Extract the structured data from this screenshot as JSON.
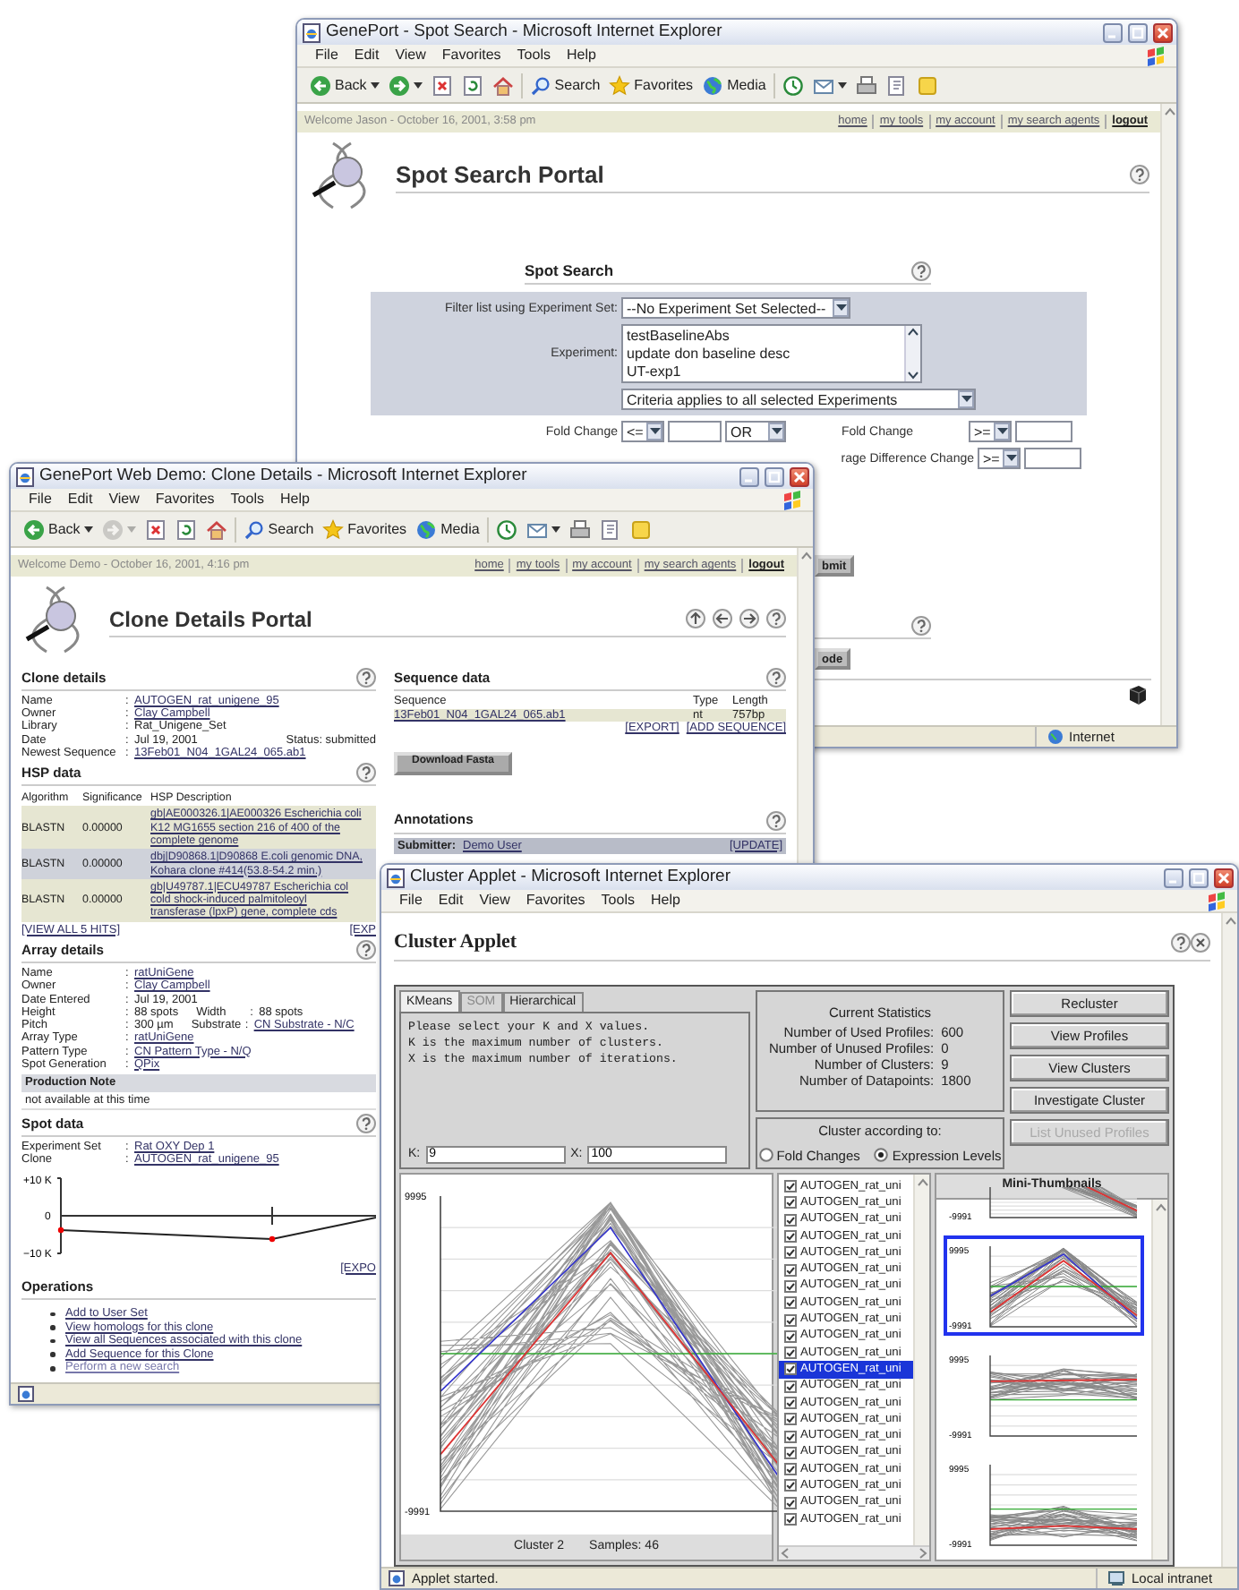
{
  "spot_search_window": {
    "title": "GenePort - Spot Search - Microsoft Internet Explorer",
    "menu": [
      "File",
      "Edit",
      "View",
      "Favorites",
      "Tools",
      "Help"
    ],
    "toolbar": [
      {
        "kind": "back",
        "label": "Back",
        "disabled": false
      },
      {
        "kind": "forward",
        "disabled": false
      },
      {
        "kind": "stop",
        "disabled": false
      },
      {
        "kind": "refresh",
        "disabled": false
      },
      {
        "kind": "home",
        "disabled": false
      },
      {
        "kind": "search",
        "label": "Search",
        "disabled": false
      },
      {
        "kind": "favorites",
        "label": "Favorites",
        "disabled": false
      },
      {
        "kind": "media",
        "label": "Media",
        "disabled": false
      },
      {
        "kind": "history",
        "disabled": false
      },
      {
        "kind": "mail",
        "disabled": false
      },
      {
        "kind": "print",
        "disabled": false
      },
      {
        "kind": "edit",
        "disabled": false
      },
      {
        "kind": "messenger",
        "disabled": false
      }
    ],
    "welcome": "Welcome Jason  -  October 16, 2001, 3:58 pm",
    "nav_links": [
      "home",
      "my tools",
      "my account",
      "my search agents",
      "logout"
    ],
    "portal_title": "Spot Search Portal",
    "form_title": "Spot Search",
    "filter": {
      "label": "Filter list using Experiment Set:",
      "value": "--No Experiment Set Selected--"
    },
    "experiment": {
      "label": "Experiment:",
      "options": [
        "testBaselineAbs",
        "update don baseline desc",
        "UT-exp1"
      ]
    },
    "criteria": "Criteria applies to all selected Experiments",
    "fold_change": {
      "label": "Fold Change",
      "operator": "<=",
      "join": "OR",
      "label_2": "Fold Change",
      "operator_2": ">="
    },
    "average_change": {
      "label": "rage Difference Change",
      "operator": ">="
    },
    "buttons": [
      "bmit",
      "ode"
    ],
    "status_zone": "Internet"
  },
  "clone_details_window": {
    "title": "GenePort Web Demo: Clone Details - Microsoft Internet Explorer",
    "menu": [
      "File",
      "Edit",
      "View",
      "Favorites",
      "Tools",
      "Help"
    ],
    "toolbar": [
      {
        "kind": "back",
        "label": "Back",
        "disabled": false
      },
      {
        "kind": "forward",
        "disabled": true
      },
      {
        "kind": "stop",
        "disabled": false
      },
      {
        "kind": "refresh",
        "disabled": false
      },
      {
        "kind": "home",
        "disabled": false
      },
      {
        "kind": "search",
        "label": "Search",
        "disabled": false
      },
      {
        "kind": "favorites",
        "label": "Favorites",
        "disabled": false
      },
      {
        "kind": "media",
        "label": "Media",
        "disabled": false
      },
      {
        "kind": "history",
        "disabled": false
      },
      {
        "kind": "mail",
        "disabled": false
      },
      {
        "kind": "print",
        "disabled": false
      },
      {
        "kind": "edit",
        "disabled": false
      },
      {
        "kind": "messenger",
        "disabled": false
      }
    ],
    "welcome": "Welcome Demo  -  October 16, 2001, 4:16 pm",
    "nav_links": [
      "home",
      "my tools",
      "my account",
      "my search agents",
      "logout"
    ],
    "portal_title": "Clone Details Portal",
    "clone_details": {
      "title": "Clone details",
      "fields": [
        {
          "label": "Name",
          "sep": ":",
          "value": "AUTOGEN_rat_unigene_95",
          "link": true
        },
        {
          "label": "Owner",
          "sep": ":",
          "value": "Clay Campbell",
          "link": true
        },
        {
          "label": "Library",
          "sep": ":",
          "value": "Rat_Unigene_Set",
          "link": false
        },
        {
          "label": "Date",
          "sep": ":",
          "value": "Jul 19, 2001",
          "link": false,
          "note": "Status: submitted"
        },
        {
          "label": "Newest Sequence",
          "sep": ":",
          "value": "13Feb01_N04_1GAL24_065.ab1",
          "link": true
        }
      ]
    },
    "hsp_data": {
      "title": "HSP data",
      "columns": [
        "Algorithm",
        "Significance",
        "HSP Description"
      ],
      "rows": [
        {
          "algorithm": "BLASTN",
          "significance": "0.00000",
          "description": [
            "gb|AE000326.1|AE000326 Escherichia coli",
            "K12 MG1655 section 216 of 400 of the",
            "complete genome"
          ]
        },
        {
          "algorithm": "BLASTN",
          "significance": "0.00000",
          "description": [
            "dbj|D90868.1|D90868 E.coli genomic DNA,",
            "Kohara clone #414(53.8-54.2 min.)"
          ]
        },
        {
          "algorithm": "BLASTN",
          "significance": "0.00000",
          "description": [
            "gb|U49787.1|ECU49787 Escherichia col",
            "cold shock-induced palmitoleoyl",
            "transferase (lpxP) gene, complete cds"
          ]
        }
      ],
      "links": [
        "[VIEW ALL 5 HITS]",
        "[EXP"
      ]
    },
    "array_details": {
      "title": "Array details",
      "fields": [
        {
          "label": "Name",
          "sep": ":",
          "value": "ratUniGene",
          "link": true
        },
        {
          "label": "Owner",
          "sep": ":",
          "value": "Clay Campbell",
          "link": true
        },
        {
          "label": "Date Entered",
          "sep": ":",
          "value": "Jul 19, 2001",
          "link": false
        },
        {
          "label": "Height",
          "sep": ":",
          "value": "88 spots",
          "link": false,
          "label_2": "Width",
          "sep_2": ":",
          "value_2": "88 spots",
          "link_2": false
        },
        {
          "label": "Pitch",
          "sep": ":",
          "value": "300 µm",
          "link": false,
          "label_2": "Substrate",
          "sep_2": ":",
          "value_2": "CN Substrate - N/C",
          "link_2": true
        },
        {
          "label": "Array Type",
          "sep": ":",
          "value": "ratUniGene",
          "link": true
        },
        {
          "label": "Pattern Type",
          "sep": ":",
          "value": "CN Pattern Type - N/Q",
          "link": true
        },
        {
          "label": "Spot Generation",
          "sep": ":",
          "value": "QPix",
          "link": true
        }
      ],
      "note_title": "Production Note",
      "note": "not available at this time"
    },
    "spot_data": {
      "title": "Spot data",
      "fields": [
        {
          "label": "Experiment Set",
          "sep": ":",
          "value": "Rat OXY Dep 1",
          "link": true
        },
        {
          "label": "Clone",
          "sep": ":",
          "value": "AUTOGEN_rat_unigene_95",
          "link": true
        }
      ],
      "axis_labels": [
        "+10 K",
        "0",
        "−10 K"
      ],
      "link": "[EXPO"
    },
    "operations": {
      "title": "Operations",
      "items": [
        {
          "label": "Add to User Set",
          "visited": false
        },
        {
          "label": "View homologs for this clone",
          "visited": false
        },
        {
          "label": "View all Sequences associated with this clone",
          "visited": false
        },
        {
          "label": "Add Sequence for this Clone",
          "visited": false
        },
        {
          "label": "Perform a new search",
          "visited": true
        }
      ]
    },
    "sequence_data": {
      "title": "Sequence data",
      "columns": [
        "Sequence",
        "Type",
        "Length"
      ],
      "rows": [
        [
          "13Feb01_N04_1GAL24_065.ab1",
          "nt",
          "757bp"
        ]
      ],
      "links": [
        "[EXPORT]",
        "[ADD SEQUENCE]"
      ]
    },
    "download_button": "Download Fasta",
    "annotations": {
      "title": "Annotations",
      "submitter_label": "Submitter:",
      "submitter": "Demo User",
      "action": "[UPDATE]"
    }
  },
  "cluster_applet_window": {
    "title": "Cluster Applet - Microsoft Internet Explorer",
    "menu": [
      "File",
      "Edit",
      "View",
      "Favorites",
      "Tools",
      "Help"
    ],
    "heading": "Cluster Applet",
    "tabs": [
      {
        "label": "KMeans",
        "selected": true,
        "disabled": false
      },
      {
        "label": "SOM",
        "selected": false,
        "disabled": true
      },
      {
        "label": "Hierarchical",
        "selected": false,
        "disabled": false
      }
    ],
    "instructions": [
      "Please select your K and X values.",
      "K is the maximum number of clusters.",
      "X is the maximum number of iterations."
    ],
    "k": {
      "label": "K:",
      "value": "9"
    },
    "x": {
      "label": "X:",
      "value": "100"
    },
    "statistics": {
      "title": "Current Statistics",
      "rows": [
        {
          "label": "Number of Used Profiles:",
          "value": "600"
        },
        {
          "label": "Number of Unused Profiles:",
          "value": "0"
        },
        {
          "label": "Number of Clusters:",
          "value": "9"
        },
        {
          "label": "Number of Datapoints:",
          "value": "1800"
        }
      ]
    },
    "cluster_by": {
      "title": "Cluster according to:",
      "options": [
        {
          "label": "Fold Changes",
          "selected": false
        },
        {
          "label": "Expression Levels",
          "selected": true
        }
      ]
    },
    "buttons": [
      {
        "label": "Recluster",
        "disabled": false
      },
      {
        "label": "View Profiles",
        "disabled": false
      },
      {
        "label": "View Clusters",
        "disabled": false
      },
      {
        "label": "Investigate Cluster",
        "disabled": false
      },
      {
        "label": "List Unused Profiles",
        "disabled": true
      }
    ],
    "plot": {
      "kind": "peak",
      "max_label": "9995",
      "min_label": "-9991",
      "cluster": "Cluster 2",
      "samples": "Samples: 46"
    },
    "profiles": [
      {
        "label": "AUTOGEN_rat_uni",
        "checked": true,
        "selected": false
      },
      {
        "label": "AUTOGEN_rat_uni",
        "checked": true,
        "selected": false
      },
      {
        "label": "AUTOGEN_rat_uni",
        "checked": true,
        "selected": false
      },
      {
        "label": "AUTOGEN_rat_uni",
        "checked": true,
        "selected": false
      },
      {
        "label": "AUTOGEN_rat_uni",
        "checked": true,
        "selected": false
      },
      {
        "label": "AUTOGEN_rat_uni",
        "checked": true,
        "selected": false
      },
      {
        "label": "AUTOGEN_rat_uni",
        "checked": true,
        "selected": false
      },
      {
        "label": "AUTOGEN_rat_uni",
        "checked": true,
        "selected": false
      },
      {
        "label": "AUTOGEN_rat_uni",
        "checked": true,
        "selected": false
      },
      {
        "label": "AUTOGEN_rat_uni",
        "checked": true,
        "selected": false
      },
      {
        "label": "AUTOGEN_rat_uni",
        "checked": true,
        "selected": false
      },
      {
        "label": "AUTOGEN_rat_uni",
        "checked": true,
        "selected": true
      },
      {
        "label": "AUTOGEN_rat_uni",
        "checked": true,
        "selected": false
      },
      {
        "label": "AUTOGEN_rat_uni",
        "checked": true,
        "selected": false
      },
      {
        "label": "AUTOGEN_rat_uni",
        "checked": true,
        "selected": false
      },
      {
        "label": "AUTOGEN_rat_uni",
        "checked": true,
        "selected": false
      },
      {
        "label": "AUTOGEN_rat_uni",
        "checked": true,
        "selected": false
      },
      {
        "label": "AUTOGEN_rat_uni",
        "checked": true,
        "selected": false
      },
      {
        "label": "AUTOGEN_rat_uni",
        "checked": true,
        "selected": false
      },
      {
        "label": "AUTOGEN_rat_uni",
        "checked": true,
        "selected": false
      },
      {
        "label": "AUTOGEN_rat_uni",
        "checked": true,
        "selected": false
      }
    ],
    "thumbnails_title": "Mini-Thumbnails",
    "thumbnails": [
      {
        "kind": "descending",
        "min_label": "-9991",
        "selected": false
      },
      {
        "kind": "peak",
        "max_label": "9995",
        "min_label": "-9991",
        "selected": true
      },
      {
        "kind": "flat",
        "max_label": "9995",
        "min_label": "-9991",
        "selected": false
      },
      {
        "kind": "low",
        "max_label": "9995",
        "min_label": "-9991",
        "selected": false
      }
    ],
    "status": "Applet started.",
    "status_zone": "Local intranet"
  }
}
